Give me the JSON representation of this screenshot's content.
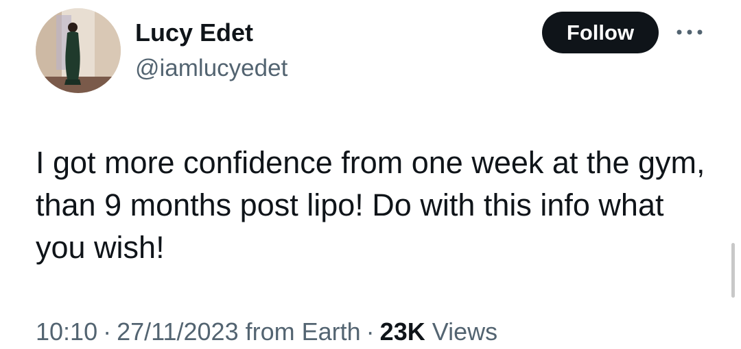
{
  "author": {
    "name": "Lucy Edet",
    "handle": "@iamlucyedet"
  },
  "follow_label": "Follow",
  "more_icon": "more-horizontal-icon",
  "tweet": {
    "text": "I got more confidence from one week at the gym, than 9 months post lipo! Do with this info what you wish!"
  },
  "meta": {
    "time": "10:10",
    "separator": "·",
    "date": "27/11/2023",
    "source": "from Earth",
    "views_count": "23K",
    "views_label": "Views"
  },
  "colors": {
    "text_primary": "#0f1419",
    "text_secondary": "#536471",
    "button_bg": "#0f1419",
    "button_text": "#ffffff",
    "background": "#ffffff"
  }
}
